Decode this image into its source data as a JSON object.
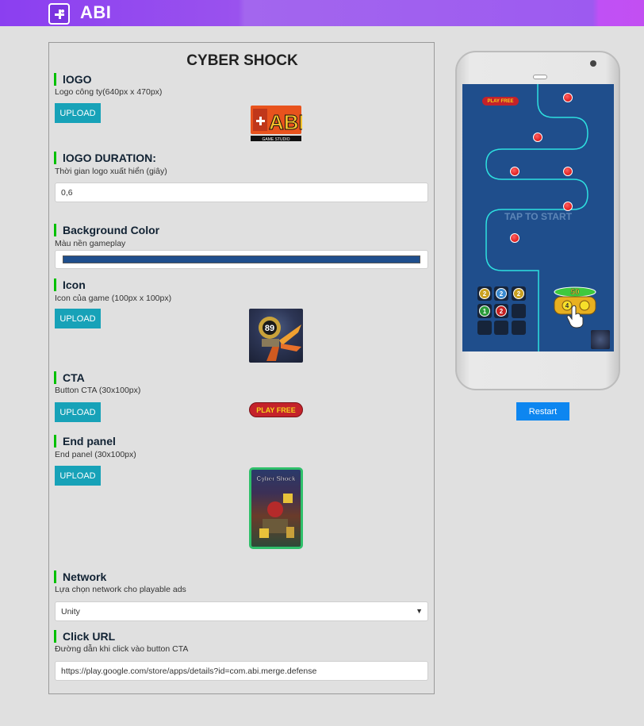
{
  "header": {
    "brand": "ABI",
    "logo_icon": "puzzle-logo-icon"
  },
  "form": {
    "title": "CYBER SHOCK",
    "sections": {
      "logo": {
        "heading": "lOGO",
        "desc": "Logo công ty(640px x 470px)",
        "button": "UPLOAD",
        "image_text": "ABI",
        "image_subtext": "GAME STUDIO"
      },
      "logo_duration": {
        "heading": "lOGO DURATION:",
        "desc": "Thời gian logo xuất hiển (giây)",
        "value": "0,6"
      },
      "background": {
        "heading": "Background Color",
        "desc": "Màu nền gameplay",
        "color": "#1f4e8c"
      },
      "icon": {
        "heading": "Icon",
        "desc": "Icon của game (100px x 100px)",
        "button": "UPLOAD",
        "icon_number": "89"
      },
      "cta": {
        "heading": "CTA",
        "desc": "Button CTA (30x100px)",
        "button": "UPLOAD",
        "cta_label": "PLAY FREE"
      },
      "end_panel": {
        "heading": "End panel",
        "desc": "End panel (30x100px)",
        "button": "UPLOAD",
        "panel_title": "Cyber Shock"
      },
      "network": {
        "heading": "Network",
        "desc": "Lựa chọn network cho playable ads",
        "selected": "Unity"
      },
      "click_url": {
        "heading": "Click URL",
        "desc": "Đường dẫn khi click vào button CTA",
        "value": "https://play.google.com/store/apps/details?id=com.abi.merge.defense"
      }
    }
  },
  "preview": {
    "cta_label": "PLAY FREE",
    "tap_text": "TAP TO START",
    "grid_numbers": [
      "2",
      "2",
      "2",
      "1",
      "2"
    ],
    "score": "50",
    "coin_value": "4",
    "restart_label": "Restart"
  },
  "colors": {
    "accent": "#17a2b8",
    "restart": "#0d86f0",
    "header_start": "#8b3ff0",
    "header_end": "#c24ff2",
    "section_bar": "#00c000"
  }
}
